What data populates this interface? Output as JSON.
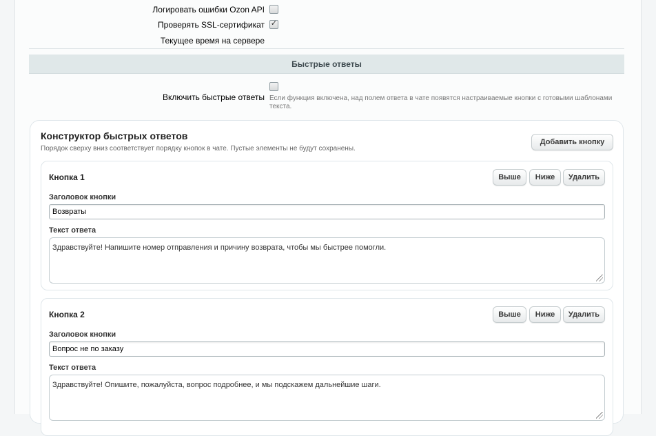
{
  "settings": {
    "log_errors_label": "Логировать ошибки Ozon API",
    "log_errors_checked": false,
    "verify_ssl_label": "Проверять SSL-сертификат",
    "verify_ssl_checked": true,
    "server_time_label": "Текущее время на сервере"
  },
  "quick_answers": {
    "section_title": "Быстрые ответы",
    "enable_label": "Включить быстрые ответы",
    "enable_checked": false,
    "enable_hint": "Если функция включена, над полем ответа в чате появятся настраиваемые кнопки с готовыми шаблонами текста."
  },
  "builder": {
    "title": "Конструктор быстрых ответов",
    "subtitle": "Порядок сверху вниз соответствует порядку кнопок в чате. Пустые элементы не будут сохранены.",
    "add_button": "Добавить кнопку",
    "up_label": "Выше",
    "down_label": "Ниже",
    "delete_label": "Удалить",
    "title_field_label": "Заголовок кнопки",
    "text_field_label": "Текст ответа",
    "buttons": [
      {
        "name": "Кнопка 1",
        "title": "Возвраты",
        "text": "Здравствуйте! Напишите номер отправления и причину возврата, чтобы мы быстрее помогли."
      },
      {
        "name": "Кнопка 2",
        "title": "Вопрос не по заказу",
        "text": "Здравствуйте! Опишите, пожалуйста, вопрос подробнее, и мы подскажем дальнейшие шаги."
      }
    ]
  }
}
